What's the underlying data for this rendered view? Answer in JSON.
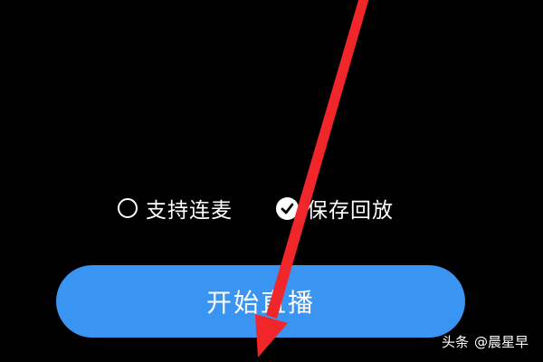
{
  "options": {
    "link_mic": {
      "label": "支持连麦",
      "checked": false
    },
    "save_replay": {
      "label": "保存回放",
      "checked": true
    }
  },
  "start_button": {
    "label": "开始直播"
  },
  "watermark": {
    "brand": "头条",
    "handle": "@晨星早"
  },
  "colors": {
    "background": "#000000",
    "button": "#3a95f2",
    "annotation_arrow": "#f0262b",
    "text": "#ffffff"
  }
}
